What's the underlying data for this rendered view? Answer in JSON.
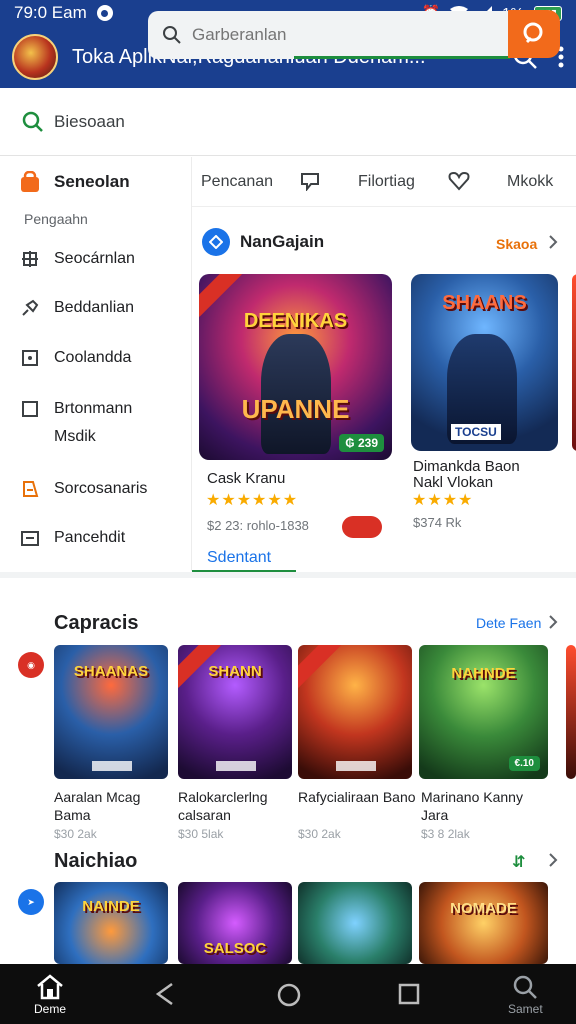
{
  "status_bar": {
    "time": "79:0 Eam",
    "signal_text": "1%"
  },
  "app_bar": {
    "title": "Toka AplikNai,Ragdarlanluan Ddenam..."
  },
  "search": {
    "label": "Biesoaan",
    "placeholder": "Garberanlan"
  },
  "sidebar": {
    "header": "Seneolan",
    "subheader": "Pengaahn",
    "items": [
      {
        "label": "Seocárnlan",
        "icon": "puzzle-icon"
      },
      {
        "label": "Beddanlian",
        "icon": "pin-icon"
      },
      {
        "label": "Coolandda",
        "icon": "square-dot-icon"
      },
      {
        "label": "Brtonmann Msdik",
        "icon": "square-icon"
      },
      {
        "label": "Sorcosanaris",
        "icon": "document-icon"
      },
      {
        "label": "Pancehdit",
        "icon": "calendar-icon"
      }
    ]
  },
  "tabs": [
    "Pencanan",
    "Filortiag",
    "Mkokk"
  ],
  "featured": {
    "title": "NanGajain",
    "more": "Skaoa",
    "footer_link": "Sdentant",
    "cards": [
      {
        "art_title": "DEENIKAS",
        "art_sub": "UPANNE",
        "price": "₲ 239",
        "name": "Cask Kranu",
        "rating": 4.5,
        "meta": "$2 23: rohlo-1838"
      },
      {
        "art_title": "SHAANS",
        "art_sub": "TOCSU",
        "name": "Dimankda Baon Nakl Vlokan",
        "rating": 3.5,
        "meta": "$374 Rk"
      }
    ]
  },
  "sections": [
    {
      "title": "Capracis",
      "more": "Dete Faen",
      "items": [
        {
          "art": "SHAANAS",
          "name": "Aaralan Mcag Bama",
          "meta": "$30 2ak"
        },
        {
          "art": "SHANN",
          "name": "Ralokarclerlng calsaran",
          "meta": "$30 5lak"
        },
        {
          "art": "",
          "name": "Rafycialiraan Bano",
          "meta": "$30 2ak"
        },
        {
          "art": "NAHNDE",
          "name": "Marinano Kanny Jara",
          "meta": "$3 8 2lak"
        }
      ]
    },
    {
      "title": "Naichiao",
      "more": "",
      "items": [
        {
          "art": "NAINDE"
        },
        {
          "art": "SALSOC"
        },
        {
          "art": ""
        },
        {
          "art": "NOMADE"
        }
      ]
    }
  ],
  "bottom_nav": {
    "home": "Deme",
    "search": "Samet"
  },
  "colors": {
    "app_bar": "#1a3f8f",
    "accent_orange": "#f26a1b",
    "accent_green": "#1e8e3e",
    "link_blue": "#1a73e8"
  }
}
